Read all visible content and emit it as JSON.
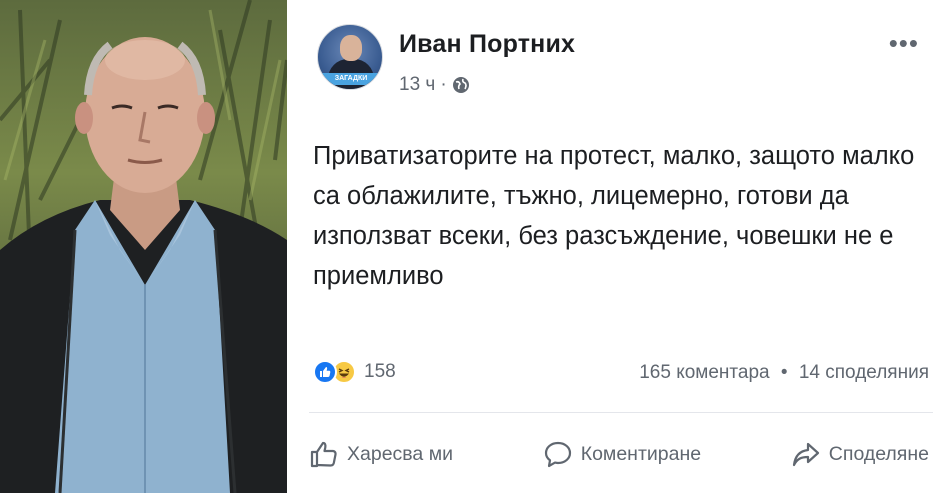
{
  "post": {
    "author": "Иван Портних",
    "time": "13 ч",
    "dot": "·",
    "more": "•••",
    "text": "Приватизаторите на протест, малко, защото малко са облажилите, тъжно, лицемерно, готови да използват всеки, без разсъждение, човешки не е приемливо",
    "avatar_banner": "ЗАГАДКИ",
    "reactions_count": "158",
    "comments": "165 коментара",
    "stats_sep": "•",
    "shares": "14 споделяния"
  },
  "actions": {
    "like": "Харесва ми",
    "comment": "Коментиране",
    "share": "Споделяне"
  },
  "colors": {
    "like_blue": "#1877f2",
    "haha_yellow": "#f7c944",
    "secondary_text": "#606770"
  },
  "icons": [
    "globe-icon",
    "more-icon",
    "like-reaction-icon",
    "haha-reaction-icon",
    "thumbs-up-icon",
    "comment-icon",
    "share-icon"
  ]
}
